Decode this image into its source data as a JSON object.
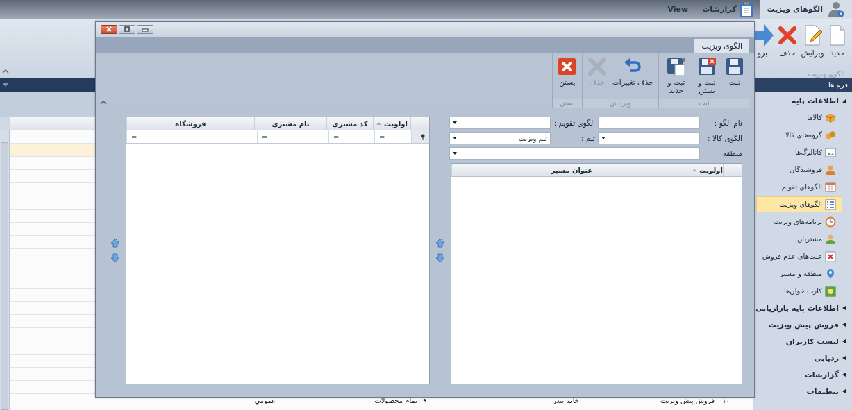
{
  "app_tabs": [
    {
      "label": "الگوهای ویزیت",
      "selected": true
    },
    {
      "label": "گزارشات",
      "selected": false
    },
    {
      "label": "View",
      "selected": false
    }
  ],
  "ribbon": {
    "group": "الگوی ویزیت",
    "buttons": [
      {
        "label": "جدید"
      },
      {
        "label": "ویرایش"
      },
      {
        "label": "حذف"
      },
      {
        "label": "برو"
      }
    ]
  },
  "sidebar": {
    "title": "فرم ها",
    "items": [
      {
        "label": "اطلاعات پایه",
        "expanded": true,
        "children": [
          {
            "label": "کالاها",
            "selected": false
          },
          {
            "label": "گروه‌های کالا",
            "selected": false
          },
          {
            "label": "کاتالوگ‌ها",
            "selected": false
          },
          {
            "label": "فروشندگان",
            "selected": false
          },
          {
            "label": "الگوهای تقویم",
            "selected": false
          },
          {
            "label": "الگوهای ویزیت",
            "selected": true
          },
          {
            "label": "برنامه‌های ویزیت",
            "selected": false
          },
          {
            "label": "مشتریان",
            "selected": false
          },
          {
            "label": "علت‌های عدم فروش",
            "selected": false
          },
          {
            "label": "منطقه و مسیر",
            "selected": false
          },
          {
            "label": "کارت خوان‌ها",
            "selected": false
          }
        ]
      },
      {
        "label": "اطلاعات پایه بازاریابی",
        "expanded": false
      },
      {
        "label": "فروش پیش ویزیت",
        "expanded": false
      },
      {
        "label": "لیست کاربران",
        "expanded": false
      },
      {
        "label": "ردیابی",
        "expanded": false
      },
      {
        "label": "گزارشات",
        "expanded": false
      },
      {
        "label": "تنظیمات",
        "expanded": false
      }
    ]
  },
  "background_table": {
    "rows": [
      {
        "selected": false
      },
      {
        "selected": true
      },
      {
        "selected": false
      },
      {
        "selected": false
      },
      {
        "selected": false
      },
      {
        "selected": false
      },
      {
        "selected": false
      },
      {
        "selected": false
      },
      {
        "selected": false
      },
      {
        "selected": false
      },
      {
        "selected": false
      },
      {
        "selected": false
      },
      {
        "selected": false
      },
      {
        "selected": false
      },
      {
        "selected": false
      },
      {
        "selected": false
      },
      {
        "selected": false
      },
      {
        "selected": false
      },
      {
        "selected": false
      },
      {
        "selected": false
      },
      {
        "selected": false,
        "cells": [
          "۱۰",
          "فروش پیش ویزیت",
          "خانم بندر",
          "۹",
          "تمام محصولات",
          "عمومي"
        ]
      }
    ]
  },
  "dialog": {
    "tab": {
      "label": "الگوی ویزیت",
      "selected": true
    },
    "groups": [
      {
        "label": "ثبت",
        "buttons": [
          {
            "label": "ثبت",
            "disabled": false
          },
          {
            "label": "ثبت و بستن",
            "disabled": false
          },
          {
            "label": "ثبت و جدید",
            "disabled": false
          }
        ]
      },
      {
        "label": "ویرایش",
        "buttons": [
          {
            "label": "حذف تغییرات",
            "disabled": false
          },
          {
            "label": "حذف",
            "disabled": true
          }
        ]
      },
      {
        "label": "بستن",
        "buttons": [
          {
            "label": "بستن",
            "disabled": false
          }
        ]
      }
    ],
    "form": {
      "fields": [
        {
          "label": "نام الگو :",
          "kind": "text"
        },
        {
          "label": "الگوی تقویم :",
          "kind": "dropdown"
        },
        {
          "label": "الگوی کالا :",
          "kind": "dropdown"
        },
        {
          "label": "تیم :",
          "kind": "dropdown",
          "value": "تیم ویزیت"
        },
        {
          "label": "منطقه :",
          "kind": "dropdown"
        }
      ]
    },
    "routes_table": {
      "columns": [
        {
          "label": "اولویت",
          "sorted": true
        },
        {
          "label": "عنوان مسیر",
          "sorted": false
        }
      ]
    },
    "customers_table": {
      "columns": [
        {
          "label": "اولویت",
          "sorted": true
        },
        {
          "label": "کد مشتری",
          "sorted": false
        },
        {
          "label": "نام مشتری",
          "sorted": false
        },
        {
          "label": "فروشگاه",
          "sorted": false
        }
      ],
      "filter_row": [
        "=",
        "=",
        "=",
        "="
      ]
    }
  }
}
